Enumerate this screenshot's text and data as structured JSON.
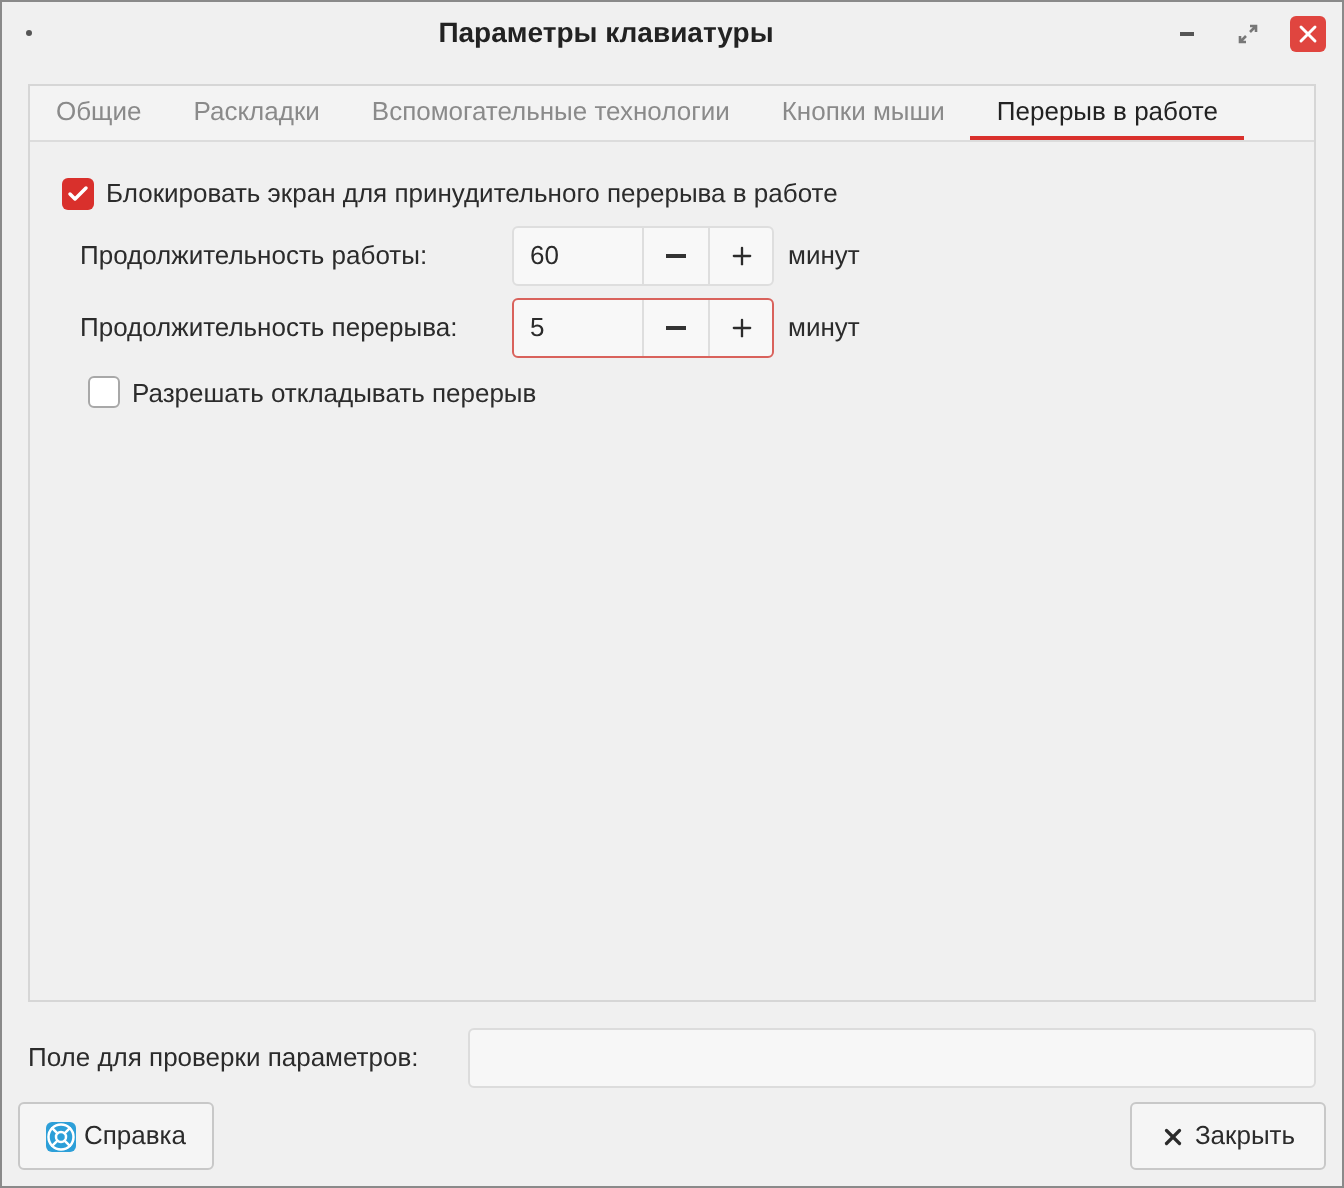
{
  "window": {
    "title": "Параметры клавиатуры"
  },
  "tabs": [
    {
      "label": "Общие",
      "selected": false
    },
    {
      "label": "Раскладки",
      "selected": false
    },
    {
      "label": "Вспомогательные технологии",
      "selected": false
    },
    {
      "label": "Кнопки мыши",
      "selected": false
    },
    {
      "label": "Перерыв в работе",
      "selected": true
    }
  ],
  "lock_screen": {
    "label": "Блокировать экран для принудительного перерыва в работе",
    "checked": true
  },
  "durations": [
    {
      "label": "Продолжительность работы:",
      "value": "60",
      "unit": "минут",
      "focused": false
    },
    {
      "label": "Продолжительность перерыва:",
      "value": "5",
      "unit": "минут",
      "focused": true
    }
  ],
  "postpone": {
    "label": "Разрешать откладывать перерыв",
    "checked": false
  },
  "test_field": {
    "label": "Поле для проверки параметров:"
  },
  "buttons": [
    {
      "label": "Справка",
      "kind": "help"
    },
    {
      "label": "Закрыть",
      "kind": "close"
    }
  ]
}
